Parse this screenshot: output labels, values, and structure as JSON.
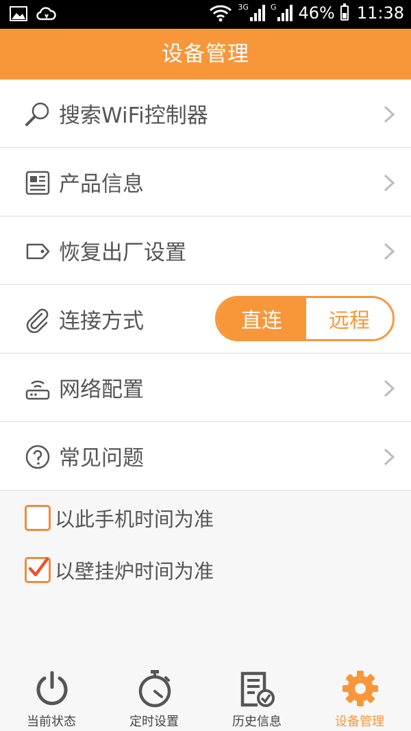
{
  "status_bar": {
    "network_3g": "3G",
    "network_g": "G",
    "battery": "46%",
    "time": "11:38"
  },
  "header": {
    "title": "设备管理"
  },
  "menu": [
    {
      "label": "搜索WiFi控制器",
      "icon": "search-icon"
    },
    {
      "label": "产品信息",
      "icon": "document-icon"
    },
    {
      "label": "恢复出厂设置",
      "icon": "tag-icon"
    },
    {
      "label": "连接方式",
      "icon": "paperclip-icon"
    },
    {
      "label": "网络配置",
      "icon": "router-icon"
    },
    {
      "label": "常见问题",
      "icon": "question-icon"
    }
  ],
  "connection_toggle": {
    "selected": "直连",
    "other": "远程"
  },
  "checkboxes": [
    {
      "label": "以此手机时间为准",
      "checked": false
    },
    {
      "label": "以壁挂炉时间为准",
      "checked": true
    }
  ],
  "bottom_nav": [
    {
      "label": "当前状态",
      "icon": "power-icon",
      "active": false
    },
    {
      "label": "定时设置",
      "icon": "stopwatch-icon",
      "active": false
    },
    {
      "label": "历史信息",
      "icon": "history-document-icon",
      "active": false
    },
    {
      "label": "设备管理",
      "icon": "gear-icon",
      "active": true
    }
  ],
  "colors": {
    "accent": "#f8963a",
    "text": "#555555",
    "divider": "#dcdcdc"
  }
}
